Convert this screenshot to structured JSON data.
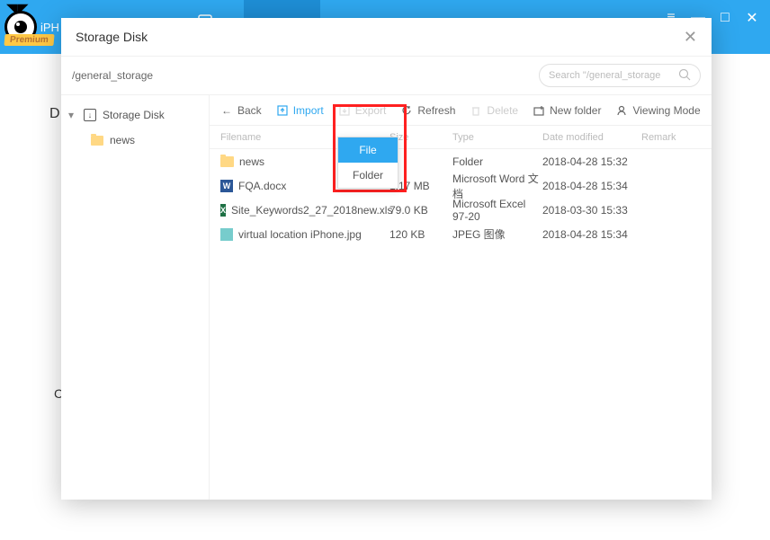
{
  "app": {
    "logo_text": "iPH",
    "premium_label": "Premium"
  },
  "modal": {
    "title": "Storage Disk",
    "path": "/general_storage",
    "search_placeholder": "Search \"/general_storage"
  },
  "sidebar": {
    "root": "Storage Disk",
    "children": [
      {
        "name": "news"
      }
    ]
  },
  "toolbar": {
    "back": "Back",
    "import": "Import",
    "export": "Export",
    "refresh": "Refresh",
    "delete": "Delete",
    "new_folder": "New folder",
    "viewing_mode": "Viewing Mode"
  },
  "columns": {
    "filename": "Filename",
    "size": "Size",
    "type": "Type",
    "date": "Date modified",
    "remark": "Remark"
  },
  "files": [
    {
      "name": "news",
      "size": "",
      "type": "Folder",
      "date": "2018-04-28 15:32",
      "icon": "folder"
    },
    {
      "name": "FQA.docx",
      "size": "1.17 MB",
      "type": "Microsoft Word 文档",
      "date": "2018-04-28 15:34",
      "icon": "word"
    },
    {
      "name": "Site_Keywords2_27_2018new.xls",
      "size": "79.0 KB",
      "type": "Microsoft Excel 97-20",
      "date": "2018-03-30 15:33",
      "icon": "excel"
    },
    {
      "name": "virtual location iPhone.jpg",
      "size": "120 KB",
      "type": "JPEG 图像",
      "date": "2018-04-28 15:34",
      "icon": "img"
    }
  ],
  "dropdown": {
    "file": "File",
    "folder": "Folder"
  },
  "bg": {
    "d": "D",
    "c": "C"
  }
}
